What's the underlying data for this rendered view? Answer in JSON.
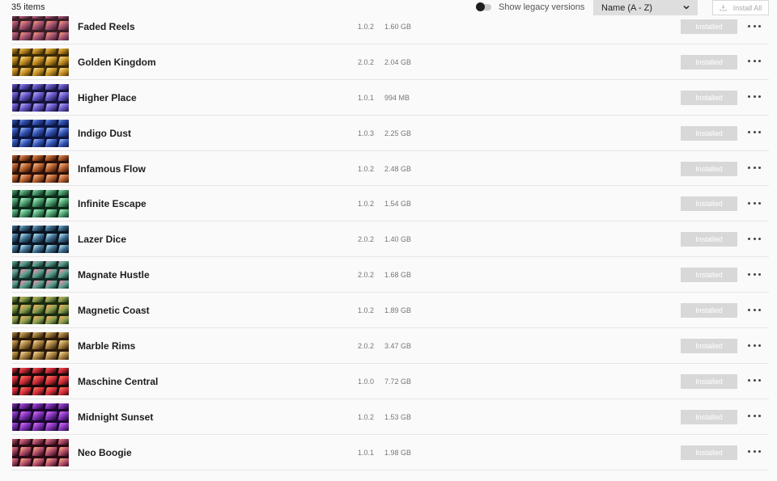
{
  "toolbar": {
    "item_count": "35 items",
    "legacy_label": "Show legacy versions",
    "sort_value": "Name (A - Z)",
    "install_all_label": "Install All"
  },
  "icons": {
    "toggle": "toggle-switch-icon",
    "sort": "chevron-down-icon",
    "install": "download-icon",
    "more": "more-dots-icon"
  },
  "items": [
    {
      "name": "Faded Reels",
      "version": "1.0.2",
      "size": "1.60 GB",
      "status": "Installed",
      "colors": [
        "#3a1e28",
        "#a05070",
        "#ff9a7a"
      ]
    },
    {
      "name": "Golden Kingdom",
      "version": "2.0.2",
      "size": "2.04 GB",
      "status": "Installed",
      "colors": [
        "#3b2a08",
        "#c08a20",
        "#ffe08a"
      ]
    },
    {
      "name": "Higher Place",
      "version": "1.0.1",
      "size": "994 MB",
      "status": "Installed",
      "colors": [
        "#14143a",
        "#6050c0",
        "#c0b0ff"
      ]
    },
    {
      "name": "Indigo Dust",
      "version": "1.0.3",
      "size": "2.25 GB",
      "status": "Installed",
      "colors": [
        "#0c1640",
        "#3050b0",
        "#a0c0ff"
      ]
    },
    {
      "name": "Infamous Flow",
      "version": "1.0.2",
      "size": "2.48 GB",
      "status": "Installed",
      "colors": [
        "#2a1008",
        "#b05a2a",
        "#ffc090"
      ]
    },
    {
      "name": "Infinite Escape",
      "version": "1.0.2",
      "size": "1.54 GB",
      "status": "Installed",
      "colors": [
        "#0c2a1a",
        "#4a9a6a",
        "#b0ffd0"
      ]
    },
    {
      "name": "Lazer Dice",
      "version": "2.0.2",
      "size": "1.40 GB",
      "status": "Installed",
      "colors": [
        "#0a1420",
        "#3a6a8a",
        "#c0f0ff"
      ]
    },
    {
      "name": "Magnate Hustle",
      "version": "2.0.2",
      "size": "1.68 GB",
      "status": "Installed",
      "colors": [
        "#102a24",
        "#5aa090",
        "#ff90b0"
      ]
    },
    {
      "name": "Magnetic Coast",
      "version": "1.0.2",
      "size": "1.89 GB",
      "status": "Installed",
      "colors": [
        "#1a2a10",
        "#8aa050",
        "#ffb060"
      ]
    },
    {
      "name": "Marble Rims",
      "version": "2.0.2",
      "size": "3.47 GB",
      "status": "Installed",
      "colors": [
        "#2a1a08",
        "#a07a3a",
        "#ffe0a0"
      ]
    },
    {
      "name": "Maschine Central",
      "version": "1.0.0",
      "size": "7.72 GB",
      "status": "Installed",
      "colors": [
        "#1a0808",
        "#d02a3a",
        "#ff7a5a"
      ]
    },
    {
      "name": "Midnight Sunset",
      "version": "1.0.2",
      "size": "1.53 GB",
      "status": "Installed",
      "colors": [
        "#1a0830",
        "#7a30b0",
        "#e070ff"
      ]
    },
    {
      "name": "Neo Boogie",
      "version": "1.0.1",
      "size": "1.98 GB",
      "status": "Installed",
      "colors": [
        "#2a0a14",
        "#b04a6a",
        "#ffb080"
      ]
    }
  ]
}
